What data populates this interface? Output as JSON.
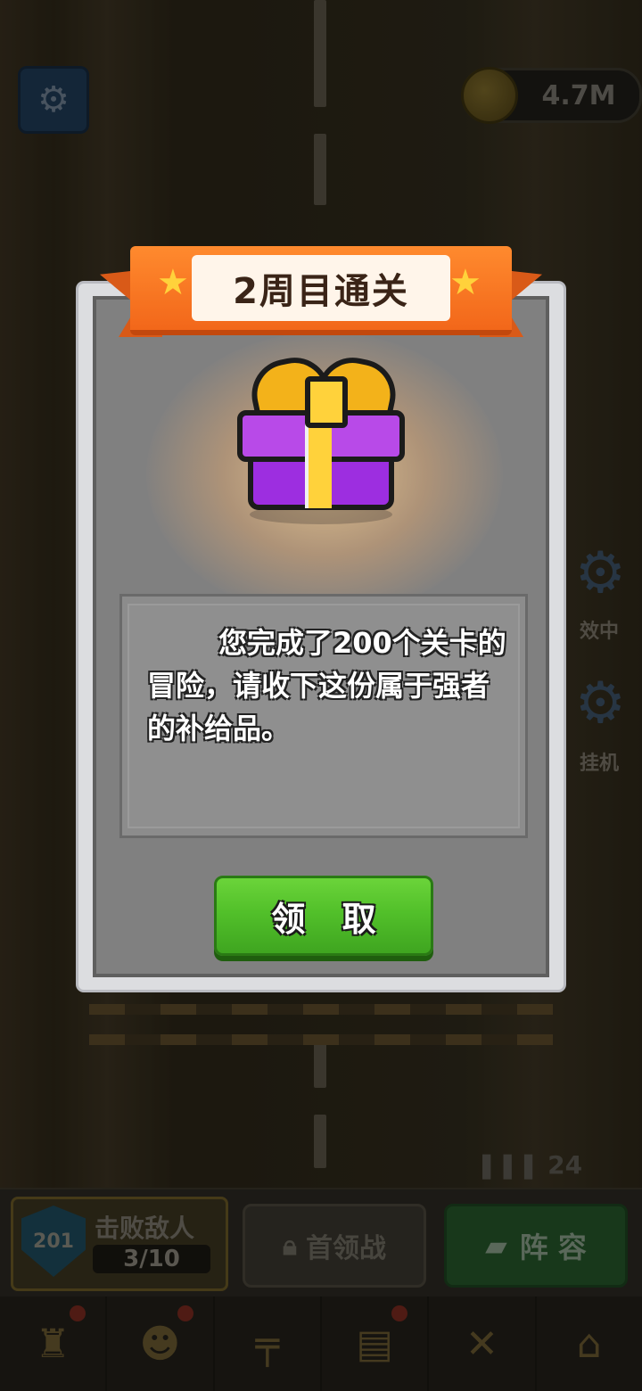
{
  "hud": {
    "coins": "4.7M",
    "side_label_1": "效中",
    "side_label_2": "挂机",
    "ammo": "24"
  },
  "bottom": {
    "level_badge": "201",
    "defeat_label": "击败敌人",
    "defeat_progress": "3/10",
    "boss_label": "首领战",
    "lineup_label": "阵 容"
  },
  "dialog": {
    "title": "2周目通关",
    "message": "您完成了200个关卡的冒险，请收下这份属于强者的补给品。",
    "claim_label": "领 取"
  },
  "icons": [
    "gear-icon",
    "coin-icon",
    "lock-icon",
    "cards-icon",
    "trophy-icon",
    "team-icon",
    "gun-icon",
    "book-icon",
    "swords-icon",
    "shop-icon",
    "gift-icon",
    "star-icon"
  ],
  "colors": {
    "banner": "#f2671a",
    "claim_button": "#52c02a",
    "gift": "#9d2ee0",
    "ribbon": "#ffd23b"
  }
}
